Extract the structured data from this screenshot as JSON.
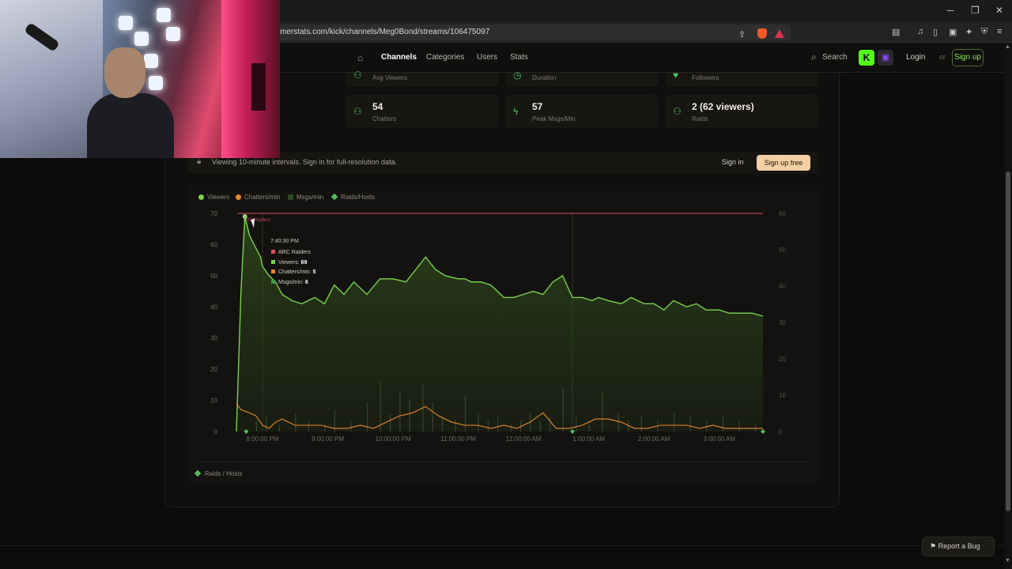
{
  "browser": {
    "url": "merstats.com/kick/channels/Meg0Bond/streams/106475097",
    "window_controls": {
      "minimize": "─",
      "restore": "❐",
      "close": "✕"
    }
  },
  "nav": {
    "links": [
      "Channels",
      "Categories",
      "Users",
      "Stats"
    ],
    "active_link": "Channels",
    "search_label": "Search",
    "login_label": "Login",
    "or_label": "or",
    "signup_label": "Sign up"
  },
  "stats_top_partial": [
    {
      "label": "Avg Viewers",
      "icon": "users-icon"
    },
    {
      "label": "Duration",
      "icon": "clock-icon"
    },
    {
      "label": "Followers",
      "icon": "heart-icon"
    }
  ],
  "stats": [
    {
      "value": "54",
      "label": "Chatters",
      "icon": "users-icon"
    },
    {
      "value": "57",
      "label": "Peak Msgs/Min",
      "icon": "bolt-icon"
    },
    {
      "value": "2 (62 viewers)",
      "label": "Raids",
      "icon": "users-icon"
    }
  ],
  "banner": {
    "text": "Viewing 10-minute intervals. Sign in for full-resolution data.",
    "sign_in": "Sign in",
    "sign_up_free": "Sign up free"
  },
  "chart_legend": [
    "Viewers",
    "Chatters/min",
    "Msgs/min",
    "Raids/Hosts"
  ],
  "footer_legend": "Raids / Hosts",
  "tooltip": {
    "time": "7:40:30 PM",
    "category": "ARC Raiders",
    "rows": [
      {
        "label": "Viewers:",
        "value": "69",
        "color": "#7cd14f"
      },
      {
        "label": "Chatters/min:",
        "value": "5",
        "color": "#e8892d"
      },
      {
        "label": "Msgs/min:",
        "value": "6",
        "color": "#3f9a3d"
      }
    ]
  },
  "report_bug": "Report a Bug",
  "colors": {
    "viewers": "#7cd14f",
    "chatters": "#e8892d",
    "msgs": "#3f9a3d",
    "category_line": "#d8505a",
    "kick_green": "#53fc18"
  },
  "chart_data": {
    "type": "line",
    "category_annotation": "ARC Raiders",
    "x_tick_labels": [
      "8:00:00 PM",
      "9:00:00 PM",
      "10:00:00 PM",
      "11:00:00 PM",
      "12:00:00 AM",
      "1:00:00 AM",
      "2:00:00 AM",
      "3:00:00 AM"
    ],
    "x_hours": [
      20,
      21,
      22,
      23,
      24,
      25,
      26,
      27
    ],
    "x_range": [
      19.6,
      27.67
    ],
    "y_left": {
      "ticks": [
        0,
        10,
        20,
        30,
        40,
        50,
        60,
        70
      ],
      "range": [
        0,
        70
      ]
    },
    "y_right": {
      "ticks": [
        0,
        10,
        20,
        30,
        40,
        50,
        60
      ],
      "range": [
        0,
        60
      ]
    },
    "series": [
      {
        "name": "Viewers",
        "axis": "left",
        "x": [
          19.6,
          19.67,
          19.73,
          19.8,
          19.87,
          19.97,
          20.0,
          20.1,
          20.2,
          20.3,
          20.45,
          20.6,
          20.8,
          20.95,
          21.1,
          21.25,
          21.4,
          21.6,
          21.8,
          22.0,
          22.2,
          22.35,
          22.5,
          22.65,
          22.8,
          23.0,
          23.1,
          23.2,
          23.35,
          23.5,
          23.7,
          23.85,
          24.0,
          24.15,
          24.3,
          24.45,
          24.6,
          24.75,
          24.9,
          25.05,
          25.15,
          25.3,
          25.5,
          25.65,
          25.85,
          26.0,
          26.15,
          26.3,
          26.5,
          26.65,
          26.8,
          27.0,
          27.15,
          27.3,
          27.5,
          27.67
        ],
        "values": [
          0,
          45,
          69,
          63,
          60,
          56,
          53,
          50,
          48,
          44,
          42,
          41,
          43,
          41,
          47,
          44,
          48,
          44,
          49,
          49,
          48,
          52,
          56,
          52,
          50,
          49,
          49,
          48,
          48,
          47,
          43,
          43,
          44,
          45,
          44,
          48,
          50,
          43,
          43,
          42,
          43,
          42,
          41,
          43,
          41,
          41,
          39,
          42,
          40,
          41,
          39,
          39,
          38,
          38,
          38,
          37
        ]
      },
      {
        "name": "Chatters/min",
        "axis": "left",
        "x": [
          19.6,
          19.67,
          19.8,
          19.9,
          20.0,
          20.1,
          20.2,
          20.3,
          20.5,
          20.7,
          20.9,
          21.1,
          21.3,
          21.5,
          21.7,
          21.9,
          22.1,
          22.3,
          22.5,
          22.7,
          22.9,
          23.1,
          23.3,
          23.5,
          23.7,
          23.9,
          24.1,
          24.3,
          24.5,
          24.7,
          24.9,
          25.1,
          25.3,
          25.5,
          25.7,
          25.9,
          26.1,
          26.3,
          26.5,
          26.7,
          26.9,
          27.1,
          27.3,
          27.5,
          27.67
        ],
        "values": [
          9,
          7,
          6,
          5,
          2,
          1,
          3,
          4,
          2,
          2,
          2,
          1,
          1,
          2,
          1,
          3,
          5,
          6,
          8,
          5,
          3,
          2,
          2,
          1,
          2,
          1,
          3,
          6,
          1,
          1,
          2,
          4,
          4,
          3,
          1,
          1,
          2,
          2,
          2,
          1,
          2,
          1,
          1,
          1,
          1
        ]
      },
      {
        "name": "Msgs/min",
        "axis": "right",
        "x": [
          19.9,
          20.05,
          20.25,
          20.5,
          20.7,
          20.95,
          21.1,
          21.35,
          21.6,
          21.8,
          21.95,
          22.1,
          22.25,
          22.45,
          22.6,
          22.75,
          22.95,
          23.1,
          23.3,
          23.45,
          23.6,
          23.8,
          23.95,
          24.1,
          24.25,
          24.4,
          24.6,
          24.8,
          25.0,
          25.2,
          25.45,
          25.6,
          25.8,
          26.05,
          26.3,
          26.55,
          26.8,
          27.05,
          27.3,
          27.55
        ],
        "values": [
          3,
          4,
          2,
          5,
          3,
          2,
          6,
          3,
          8,
          14,
          5,
          11,
          9,
          13,
          8,
          4,
          3,
          10,
          5,
          3,
          4,
          2,
          3,
          5,
          3,
          4,
          12,
          4,
          3,
          11,
          5,
          3,
          4,
          3,
          5,
          4,
          3,
          4,
          3,
          2
        ]
      }
    ],
    "raids_hosts_x": [
      19.75,
      24.75,
      27.67
    ],
    "vertical_markers_x": [
      20.0,
      24.75
    ]
  }
}
